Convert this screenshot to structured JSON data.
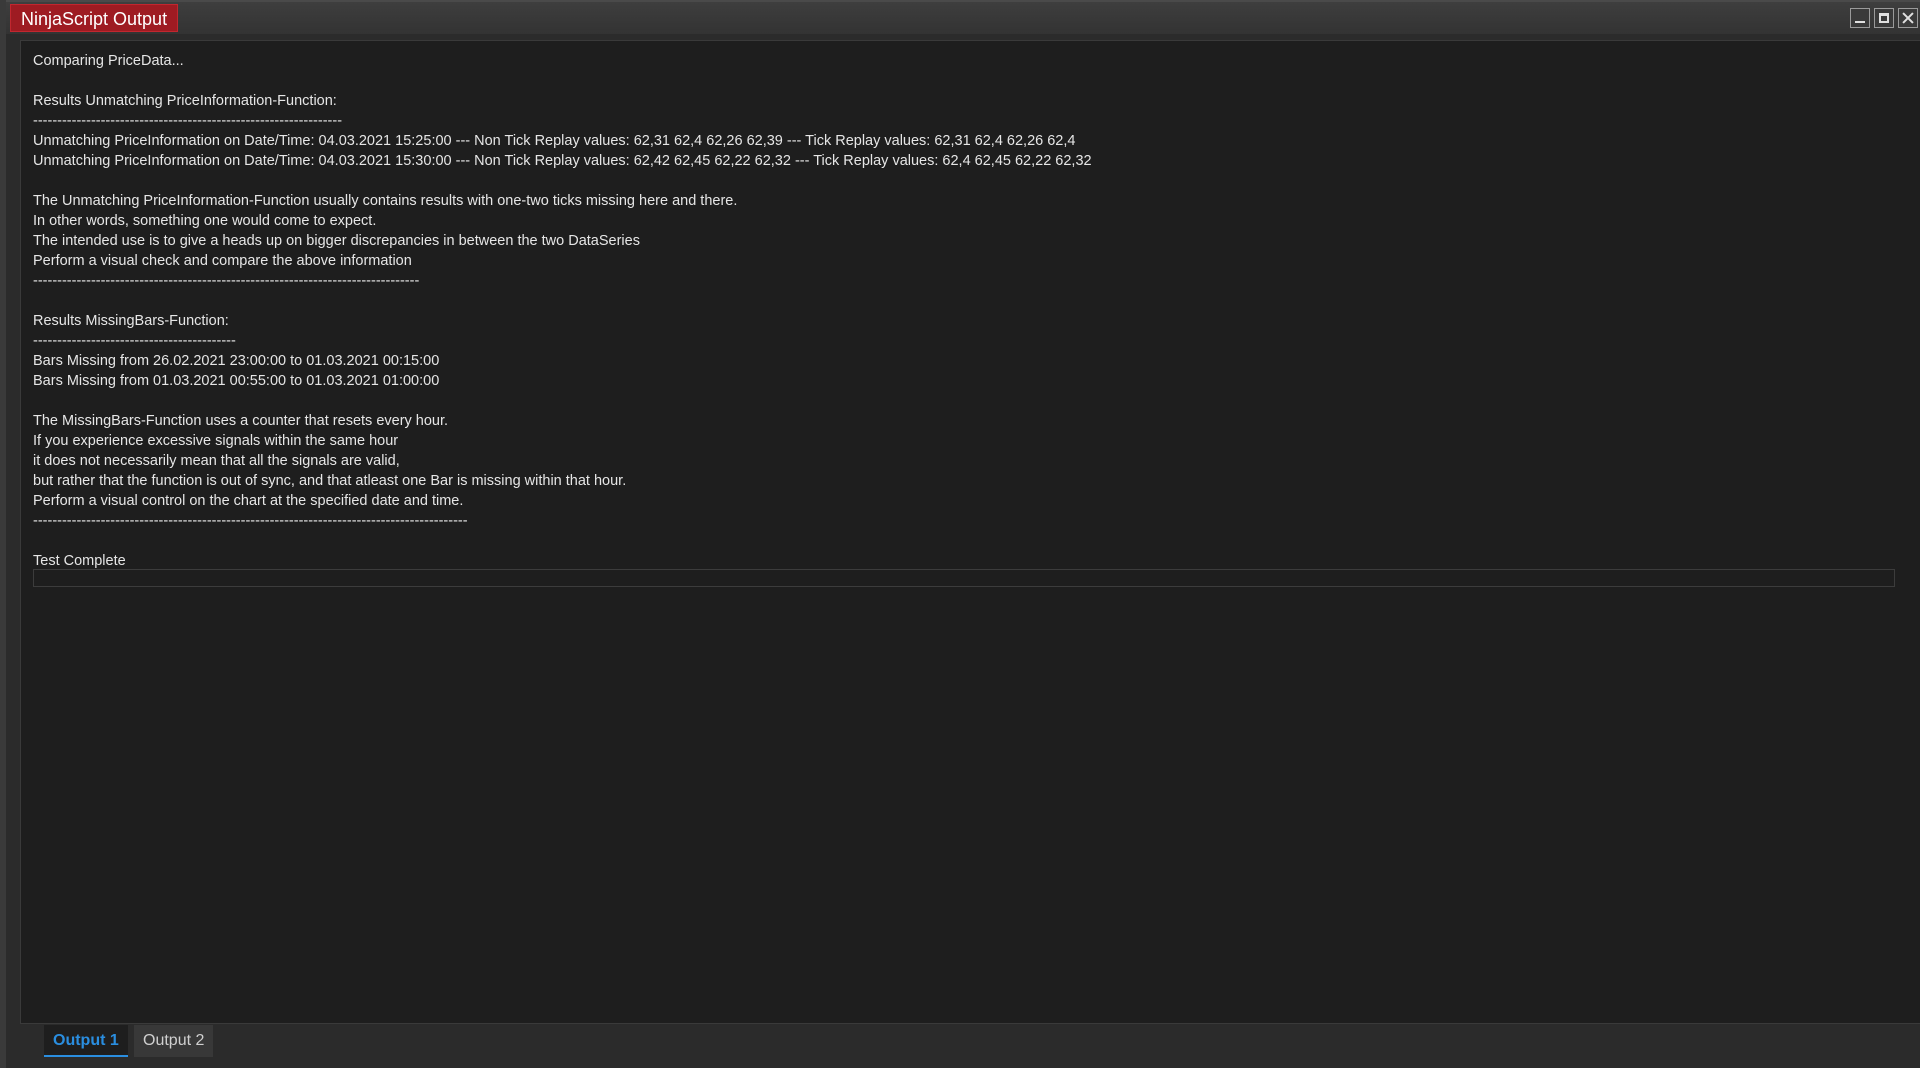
{
  "window": {
    "title": "NinjaScript Output",
    "accent_color": "#9e1b22",
    "controls": [
      "minimize-icon",
      "maximize-icon",
      "close-icon"
    ]
  },
  "output": {
    "lines": [
      "Comparing PriceData...",
      "",
      "Results Unmatching PriceInformation-Function:",
      "----------------------------------------------------------------",
      "Unmatching PriceInformation on Date/Time: 04.03.2021 15:25:00 --- Non Tick Replay values: 62,31 62,4 62,26 62,39 --- Tick Replay values: 62,31 62,4 62,26 62,4",
      "Unmatching PriceInformation on Date/Time: 04.03.2021 15:30:00 --- Non Tick Replay values: 62,42 62,45 62,22 62,32 --- Tick Replay values: 62,4 62,45 62,22 62,32",
      "",
      "The Unmatching PriceInformation-Function usually contains results with one-two ticks missing here and there.",
      "In other words, something one would come to expect.",
      "The intended use is to give a heads up on bigger discrepancies in between the two DataSeries",
      "Perform a visual check and compare the above information",
      "--------------------------------------------------------------------------------",
      "",
      "Results MissingBars-Function:",
      "------------------------------------------",
      "Bars Missing from 26.02.2021 23:00:00 to 01.03.2021 00:15:00",
      "Bars Missing from 01.03.2021 00:55:00 to 01.03.2021 01:00:00",
      "",
      "The MissingBars-Function uses a counter that resets every hour.",
      "If you experience excessive signals within the same hour",
      "it does not necessarily mean that all the signals are valid,",
      "but rather that the function is out of sync, and that atleast one Bar is missing within that hour.",
      "Perform a visual control on the chart at the specified date and time.",
      "------------------------------------------------------------------------------------------",
      "",
      "Test Complete"
    ],
    "input_value": ""
  },
  "tabs": [
    {
      "label": "Output 1",
      "active": true,
      "color": "#2a8ee0"
    },
    {
      "label": "Output 2",
      "active": false
    }
  ]
}
